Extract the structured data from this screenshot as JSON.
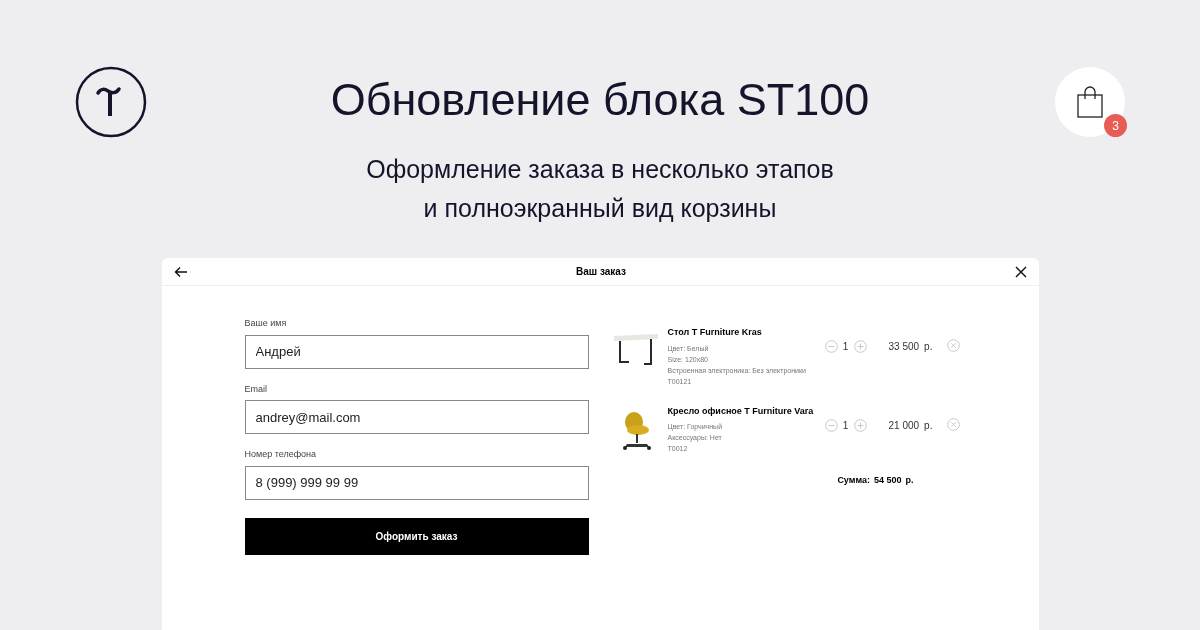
{
  "header": {
    "title": "Обновление блока ST100",
    "subtitle_lines": [
      "Оформление заказа в несколько этапов",
      "и полноэкранный вид корзины"
    ]
  },
  "cart": {
    "count": "3"
  },
  "modal": {
    "title": "Ваш заказ",
    "fields": [
      {
        "label": "Ваше имя",
        "value": "Андрей"
      },
      {
        "label": "Email",
        "value": "andrey@mail.com"
      },
      {
        "label": "Номер телефона",
        "value": "8 (999) 999 99 99"
      }
    ],
    "submit": "Оформить заказ",
    "items": [
      {
        "kind": "table",
        "name": "Стол T Furniture Kras",
        "details": [
          "Цвет: Белый",
          "Size: 120x80",
          "Встроенная электроника: Без электроники",
          "T00121"
        ],
        "quantity": "1",
        "price": "33 500",
        "currency": "р."
      },
      {
        "kind": "chair",
        "name": "Кресло офисное T Furniture Vara",
        "details": [
          "Цвет: Горчичный",
          "Аксессуары: Нет",
          "T0012"
        ],
        "quantity": "1",
        "price": "21 000",
        "currency": "р."
      }
    ],
    "total": {
      "label": "Сумма:",
      "value": "54 500",
      "currency": "р."
    }
  }
}
